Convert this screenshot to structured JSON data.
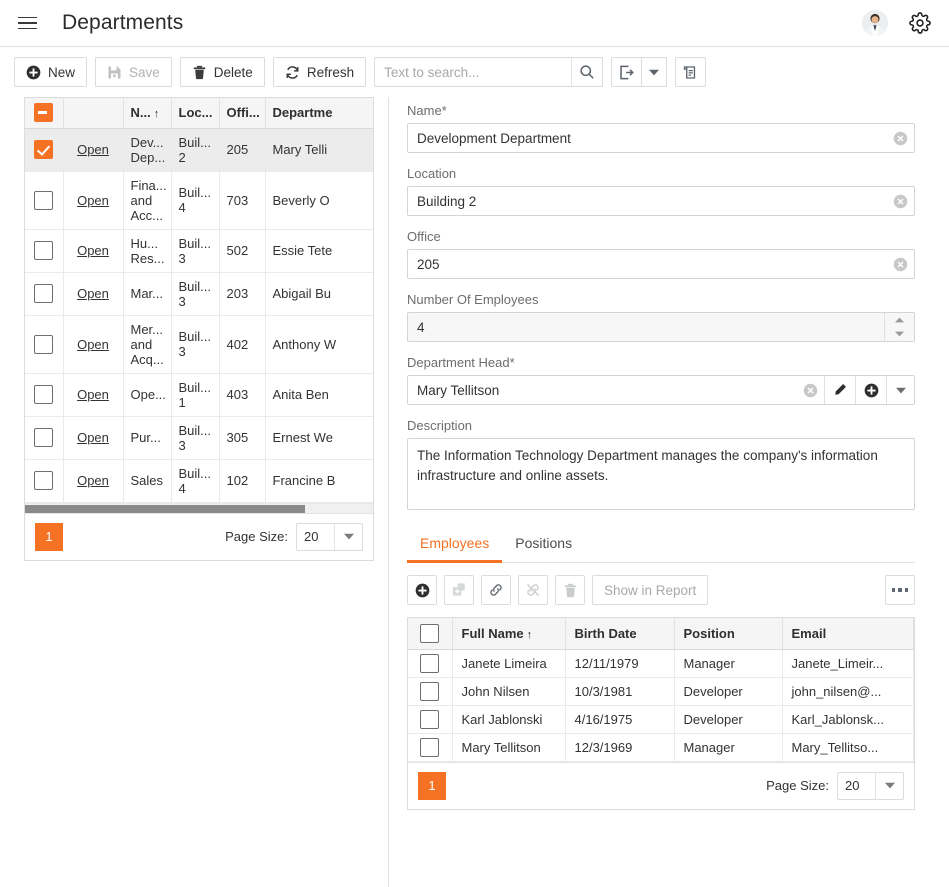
{
  "header": {
    "menu_icon": "hamburger-icon",
    "title": "Departments",
    "avatar_icon": "user-avatar",
    "settings_icon": "gear-icon"
  },
  "toolbar": {
    "new_label": "New",
    "save_label": "Save",
    "delete_label": "Delete",
    "refresh_label": "Refresh",
    "search_placeholder": "Text to search...",
    "search_value": "",
    "search_icon": "search-icon",
    "export_icon": "export-icon",
    "export_dropdown_icon": "chevron-down-icon",
    "report_icon": "report-icon"
  },
  "departments_grid": {
    "columns": [
      {
        "key": "checkbox",
        "label": ""
      },
      {
        "key": "open",
        "label": ""
      },
      {
        "key": "name",
        "label": "N...",
        "sorted": "asc",
        "sort_glyph": "↑"
      },
      {
        "key": "location",
        "label": "Loc..."
      },
      {
        "key": "office",
        "label": "Offi..."
      },
      {
        "key": "head",
        "label": "Departme"
      }
    ],
    "header_checkbox_state": "indeterminate",
    "open_link_label": "Open",
    "rows": [
      {
        "selected": true,
        "checked": true,
        "name": "Dev... Dep...",
        "location": "Buil... 2",
        "office": "205",
        "head": "Mary Telli"
      },
      {
        "selected": false,
        "checked": false,
        "name": "Fina... and Acc...",
        "location": "Buil... 4",
        "office": "703",
        "head": "Beverly O"
      },
      {
        "selected": false,
        "checked": false,
        "name": "Hu... Res...",
        "location": "Buil... 3",
        "office": "502",
        "head": "Essie Tete"
      },
      {
        "selected": false,
        "checked": false,
        "name": "Mar...",
        "location": "Buil... 3",
        "office": "203",
        "head": "Abigail Bu"
      },
      {
        "selected": false,
        "checked": false,
        "name": "Mer... and Acq...",
        "location": "Buil... 3",
        "office": "402",
        "head": "Anthony W"
      },
      {
        "selected": false,
        "checked": false,
        "name": "Ope...",
        "location": "Buil... 1",
        "office": "403",
        "head": "Anita Ben"
      },
      {
        "selected": false,
        "checked": false,
        "name": "Pur...",
        "location": "Buil... 3",
        "office": "305",
        "head": "Ernest We"
      },
      {
        "selected": false,
        "checked": false,
        "name": "Sales",
        "location": "Buil... 4",
        "office": "102",
        "head": "Francine B"
      }
    ],
    "pager": {
      "current_page": "1",
      "page_size_label": "Page Size:",
      "page_size_value": "20",
      "dropdown_icon": "chevron-down-icon"
    }
  },
  "form": {
    "name": {
      "label": "Name*",
      "value": "Development Department",
      "clear_icon": "clear-circle-icon"
    },
    "location": {
      "label": "Location",
      "value": "Building 2",
      "clear_icon": "clear-circle-icon"
    },
    "office": {
      "label": "Office",
      "value": "205",
      "clear_icon": "clear-circle-icon"
    },
    "employees_count": {
      "label": "Number Of Employees",
      "value": "4",
      "spinner_up": "▲",
      "spinner_down": "▼"
    },
    "department_head": {
      "label": "Department Head*",
      "value": "Mary Tellitson",
      "clear_icon": "clear-circle-icon",
      "edit_icon": "pencil-icon",
      "add_icon": "plus-circle-icon",
      "dropdown_icon": "chevron-down-icon"
    },
    "description": {
      "label": "Description",
      "value": "The Information Technology Department manages the company's information infrastructure and online assets."
    }
  },
  "detail_tabs": [
    {
      "label": "Employees",
      "active": true
    },
    {
      "label": "Positions",
      "active": false
    }
  ],
  "detail_toolbar": {
    "add_icon": "plus-circle-icon",
    "add_new_icon": "add-copy-icon",
    "link_icon": "link-icon",
    "unlink_icon": "unlink-icon",
    "delete_icon": "trash-icon",
    "show_in_report_label": "Show in Report",
    "more_icon": "ellipsis-icon"
  },
  "employees_grid": {
    "columns": [
      {
        "key": "checkbox",
        "label": ""
      },
      {
        "key": "full_name",
        "label": "Full Name",
        "sorted": "asc",
        "sort_glyph": "↑"
      },
      {
        "key": "birth_date",
        "label": "Birth Date"
      },
      {
        "key": "position",
        "label": "Position"
      },
      {
        "key": "email",
        "label": "Email"
      }
    ],
    "rows": [
      {
        "checked": false,
        "full_name": "Janete Limeira",
        "birth_date": "12/11/1979",
        "position": "Manager",
        "email": "Janete_Limeir..."
      },
      {
        "checked": false,
        "full_name": "John Nilsen",
        "birth_date": "10/3/1981",
        "position": "Developer",
        "email": "john_nilsen@..."
      },
      {
        "checked": false,
        "full_name": "Karl Jablonski",
        "birth_date": "4/16/1975",
        "position": "Developer",
        "email": "Karl_Jablonsk..."
      },
      {
        "checked": false,
        "full_name": "Mary Tellitson",
        "birth_date": "12/3/1969",
        "position": "Manager",
        "email": "Mary_Tellitso..."
      }
    ],
    "pager": {
      "current_page": "1",
      "page_size_label": "Page Size:",
      "page_size_value": "20",
      "dropdown_icon": "chevron-down-icon"
    }
  },
  "colors": {
    "accent": "#f57224",
    "border": "#dcdcdc",
    "header_bg": "#f5f5f5",
    "selected_row": "#ececec",
    "label_text": "#6d6d6d"
  }
}
